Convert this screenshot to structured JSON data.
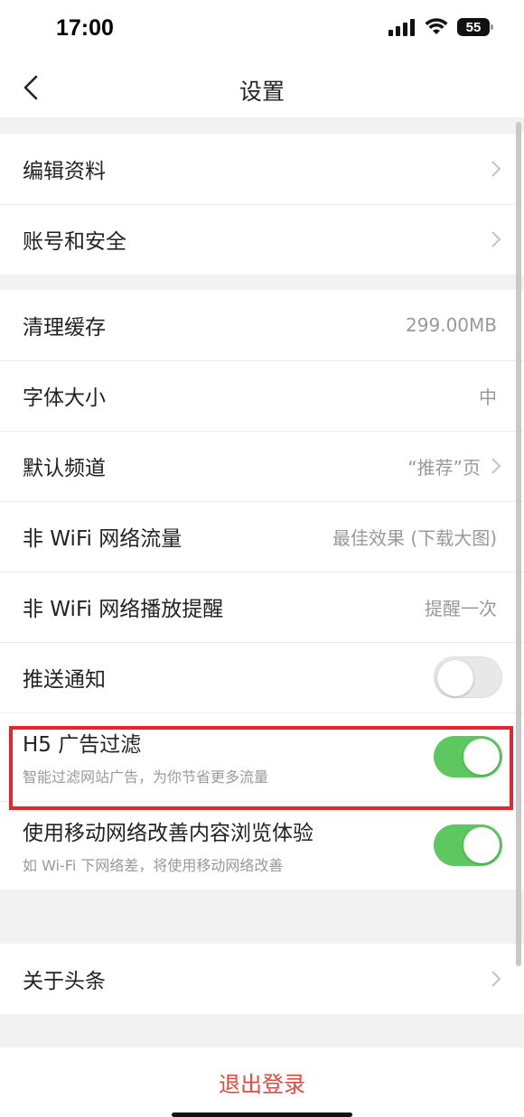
{
  "status": {
    "time": "17:00",
    "battery": "55"
  },
  "nav": {
    "title": "设置"
  },
  "group1": [
    {
      "label": "编辑资料"
    },
    {
      "label": "账号和安全"
    }
  ],
  "group2": {
    "cache": {
      "label": "清理缓存",
      "value": "299.00MB"
    },
    "font": {
      "label": "字体大小",
      "value": "中"
    },
    "channel": {
      "label": "默认频道",
      "value": "“推荐”页"
    },
    "traffic": {
      "label": "非 WiFi 网络流量",
      "value": "最佳效果 (下载大图)"
    },
    "playback": {
      "label": "非 WiFi 网络播放提醒",
      "value": "提醒一次"
    },
    "push": {
      "label": "推送通知",
      "on": false
    },
    "adfilter": {
      "label": "H5 广告过滤",
      "sub": "智能过滤网站广告，为你节省更多流量",
      "on": true
    },
    "mobile": {
      "label": "使用移动网络改善内容浏览体验",
      "sub": "如 Wi-Fi 下网络差，将使用移动网络改善",
      "on": true
    }
  },
  "group3": [
    {
      "label": "关于头条"
    }
  ],
  "logout": {
    "label": "退出登录"
  },
  "colors": {
    "accent_red": "#e04a3f",
    "toggle_on": "#5dc85f",
    "highlight": "#e8252f"
  }
}
